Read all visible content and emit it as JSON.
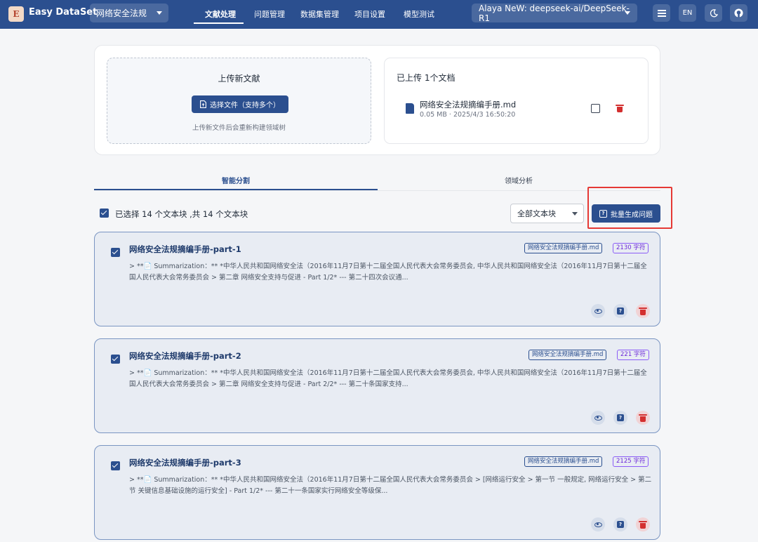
{
  "app": {
    "logo_text": "E",
    "title": "Easy DataSet",
    "project": "网络安全法规",
    "model": "Alaya NeW: deepseek-ai/DeepSeek-R1",
    "lang_button": "EN"
  },
  "nav": {
    "items": [
      {
        "label": "文献处理",
        "active": true
      },
      {
        "label": "问题管理",
        "active": false
      },
      {
        "label": "数据集管理",
        "active": false
      },
      {
        "label": "项目设置",
        "active": false
      },
      {
        "label": "模型测试",
        "active": false
      }
    ]
  },
  "upload": {
    "title": "上传新文献",
    "button": "选择文件（支持多个）",
    "hint": "上传新文件后会重新构建领域树"
  },
  "uploaded": {
    "title": "已上传 1个文档",
    "file": {
      "name": "网络安全法规摘编手册.md",
      "meta": "0.05 MB · 2025/4/3 16:50:20"
    }
  },
  "tabs": [
    {
      "label": "智能分割",
      "active": true
    },
    {
      "label": "领域分析",
      "active": false
    }
  ],
  "toolbar": {
    "selection_text": "已选择 14 个文本块 ,共 14 个文本块",
    "filter": "全部文本块",
    "batch_button": "批量生成问题"
  },
  "colors": {
    "primary": "#2b4f8f",
    "highlight": "#e53935",
    "danger": "#d32f2f"
  },
  "chunks": [
    {
      "title": "网络安全法规摘编手册-part-1",
      "file_tag": "网络安全法规摘编手册.md",
      "size_tag": "2130 字符",
      "summary": "> **📄 Summarization：** *中华人民共和国网络安全法（2016年11月7日第十二届全国人民代表大会常务委员会, 中华人民共和国网络安全法（2016年11月7日第十二届全国人民代表大会常务委员会 > 第二章 网络安全支持与促进 - Part 1/2* --- 第二十四次会议通..."
    },
    {
      "title": "网络安全法规摘编手册-part-2",
      "file_tag": "网络安全法规摘编手册.md",
      "size_tag": "221 字符",
      "summary": "> **📄 Summarization：** *中华人民共和国网络安全法（2016年11月7日第十二届全国人民代表大会常务委员会, 中华人民共和国网络安全法（2016年11月7日第十二届全国人民代表大会常务委员会 > 第二章 网络安全支持与促进 - Part 2/2* --- 第二十条国家支持..."
    },
    {
      "title": "网络安全法规摘编手册-part-3",
      "file_tag": "网络安全法规摘编手册.md",
      "size_tag": "2125 字符",
      "summary": "> **📄 Summarization：** *中华人民共和国网络安全法（2016年11月7日第十二届全国人民代表大会常务委员会 > [网络运行安全 > 第一节 一般规定, 网络运行安全 > 第二节 关键信息基础设施的运行安全] - Part 1/2* --- 第二十一条国家实行网络安全等级保..."
    }
  ]
}
